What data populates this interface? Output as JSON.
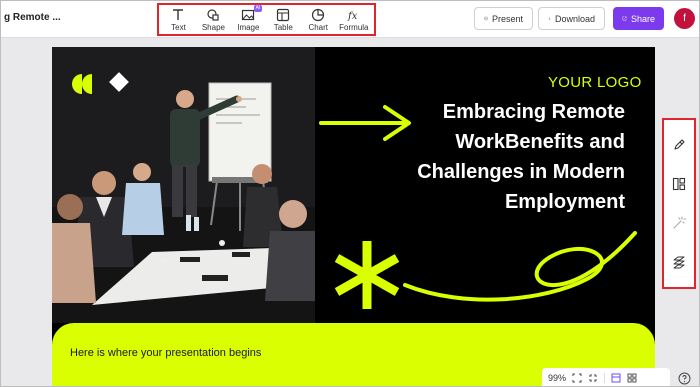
{
  "app": {
    "doc_title": "g Remote ..."
  },
  "toolbar": {
    "tools": [
      {
        "label": "Text",
        "icon": "text-icon"
      },
      {
        "label": "Shape",
        "icon": "shape-icon"
      },
      {
        "label": "Image",
        "icon": "image-icon",
        "badge": "AI"
      },
      {
        "label": "Table",
        "icon": "table-icon"
      },
      {
        "label": "Chart",
        "icon": "chart-icon"
      },
      {
        "label": "Formula",
        "icon": "formula-icon"
      }
    ],
    "present_label": "Present",
    "download_label": "Download",
    "share_label": "Share",
    "avatar_initial": "f",
    "share_color": "#7c3aed"
  },
  "slide": {
    "logo_text": "YOUR LOGO",
    "title": "Embracing Remote WorkBenefits and Challenges in Modern Employment",
    "subtitle": "Here is where your presentation begins",
    "accent_color": "#d9ff00"
  },
  "right_panel": {
    "icons": [
      "pen-icon",
      "layout-icon",
      "magic-wand-icon",
      "transition-icon"
    ]
  },
  "zoom": {
    "level": "99%"
  }
}
